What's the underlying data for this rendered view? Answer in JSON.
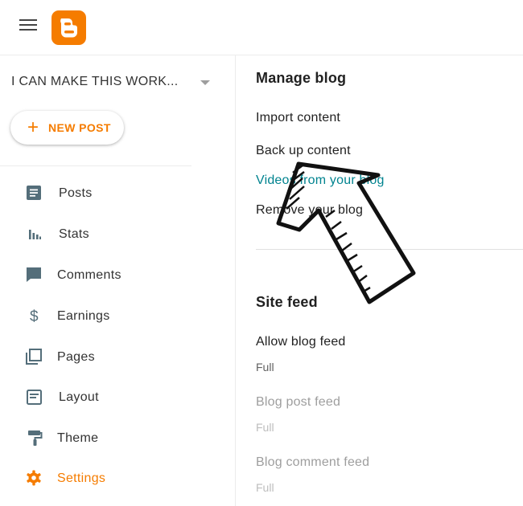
{
  "colors": {
    "accent": "#f57c00",
    "link": "#00838f"
  },
  "header": {
    "menu_icon": "menu-icon",
    "logo_icon": "blogger-logo-icon"
  },
  "sidebar": {
    "blog_name": "I CAN MAKE THIS WORK...",
    "new_post_label": "NEW POST",
    "items": [
      {
        "label": "Posts",
        "icon": "posts-icon"
      },
      {
        "label": "Stats",
        "icon": "stats-icon"
      },
      {
        "label": "Comments",
        "icon": "comments-icon"
      },
      {
        "label": "Earnings",
        "icon": "dollar-icon"
      },
      {
        "label": "Pages",
        "icon": "pages-icon"
      },
      {
        "label": "Layout",
        "icon": "layout-icon"
      },
      {
        "label": "Theme",
        "icon": "paint-roller-icon"
      },
      {
        "label": "Settings",
        "icon": "gear-icon",
        "active": true
      }
    ]
  },
  "manage_blog": {
    "title": "Manage blog",
    "items": [
      {
        "label": "Import content"
      },
      {
        "label": "Back up content"
      },
      {
        "label": "Videos from your blog",
        "style": "link"
      },
      {
        "label": "Remove your blog"
      }
    ]
  },
  "site_feed": {
    "title": "Site feed",
    "items": [
      {
        "label": "Allow blog feed",
        "value": "Full"
      },
      {
        "label": "Blog post feed",
        "value": "Full"
      },
      {
        "label": "Blog comment feed",
        "value": "Full"
      }
    ]
  }
}
